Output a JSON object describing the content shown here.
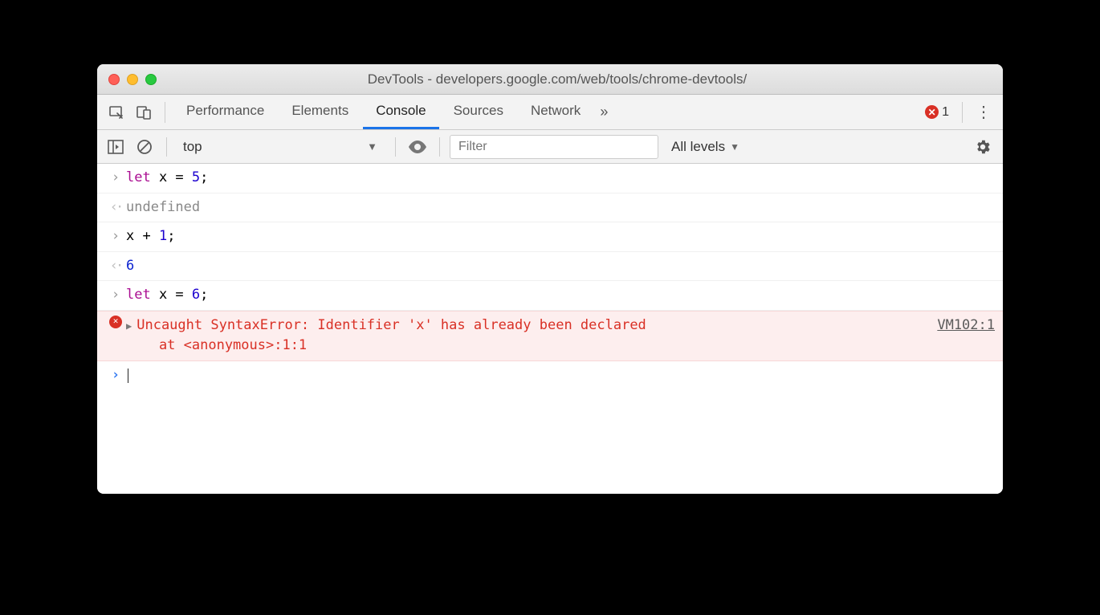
{
  "window": {
    "title": "DevTools - developers.google.com/web/tools/chrome-devtools/"
  },
  "tabs": {
    "items": [
      "Performance",
      "Elements",
      "Console",
      "Sources",
      "Network"
    ],
    "active": "Console",
    "overflow_glyph": "»",
    "error_count": "1"
  },
  "subbar": {
    "context": "top",
    "filter_placeholder": "Filter",
    "levels_label": "All levels"
  },
  "console": {
    "rows": [
      {
        "kind": "in",
        "html": "<span class='tok-kw'>let</span> x = <span class='tok-num'>5</span>;"
      },
      {
        "kind": "out",
        "html": "<span class='tok-undef'>undefined</span>"
      },
      {
        "kind": "in",
        "html": "x + <span class='tok-num'>1</span>;"
      },
      {
        "kind": "out",
        "html": "<span class='tok-res'>6</span>"
      },
      {
        "kind": "in",
        "html": "<span class='tok-kw'>let</span> x = <span class='tok-num'>6</span>;"
      },
      {
        "kind": "err",
        "text": "Uncaught SyntaxError: Identifier 'x' has already been declared\n    at <anonymous>:1:1",
        "source": "VM102:1"
      }
    ]
  }
}
